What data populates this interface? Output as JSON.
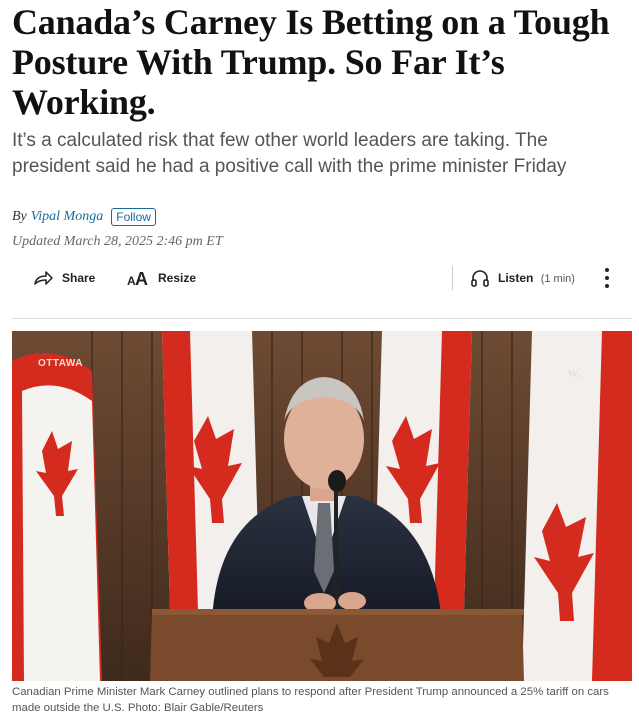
{
  "article": {
    "headline": "Canada’s Carney Is Betting on a Tough Posture With Trump. So Far It’s Working.",
    "dek": "It’s a calculated risk that few other world leaders are taking. The president said he had a positive call with the prime minister Friday",
    "byline_prefix": "By",
    "author": "Vipal Monga",
    "follow_label": "Follow",
    "updated": "Updated March 28, 2025 2:46 pm ET"
  },
  "toolbar": {
    "share_label": "Share",
    "resize_label": "Resize",
    "listen_label": "Listen",
    "listen_duration": "(1 min)",
    "share_icon": "share-arrow-icon",
    "resize_icon": "text-resize-icon",
    "listen_icon": "headphones-icon",
    "more_icon": "more-vertical-icon"
  },
  "photo": {
    "location_label": "OTTAWA",
    "logo_text": "W..",
    "caption": "Canadian Prime Minister Mark Carney outlined plans to respond after President Trump announced a 25% tariff on cars made outside the U.S. Photo: Blair Gable/Reuters"
  },
  "colors": {
    "author_link": "#1a6b9a",
    "flag_red": "#d52b1e",
    "dek_gray": "#555555"
  }
}
